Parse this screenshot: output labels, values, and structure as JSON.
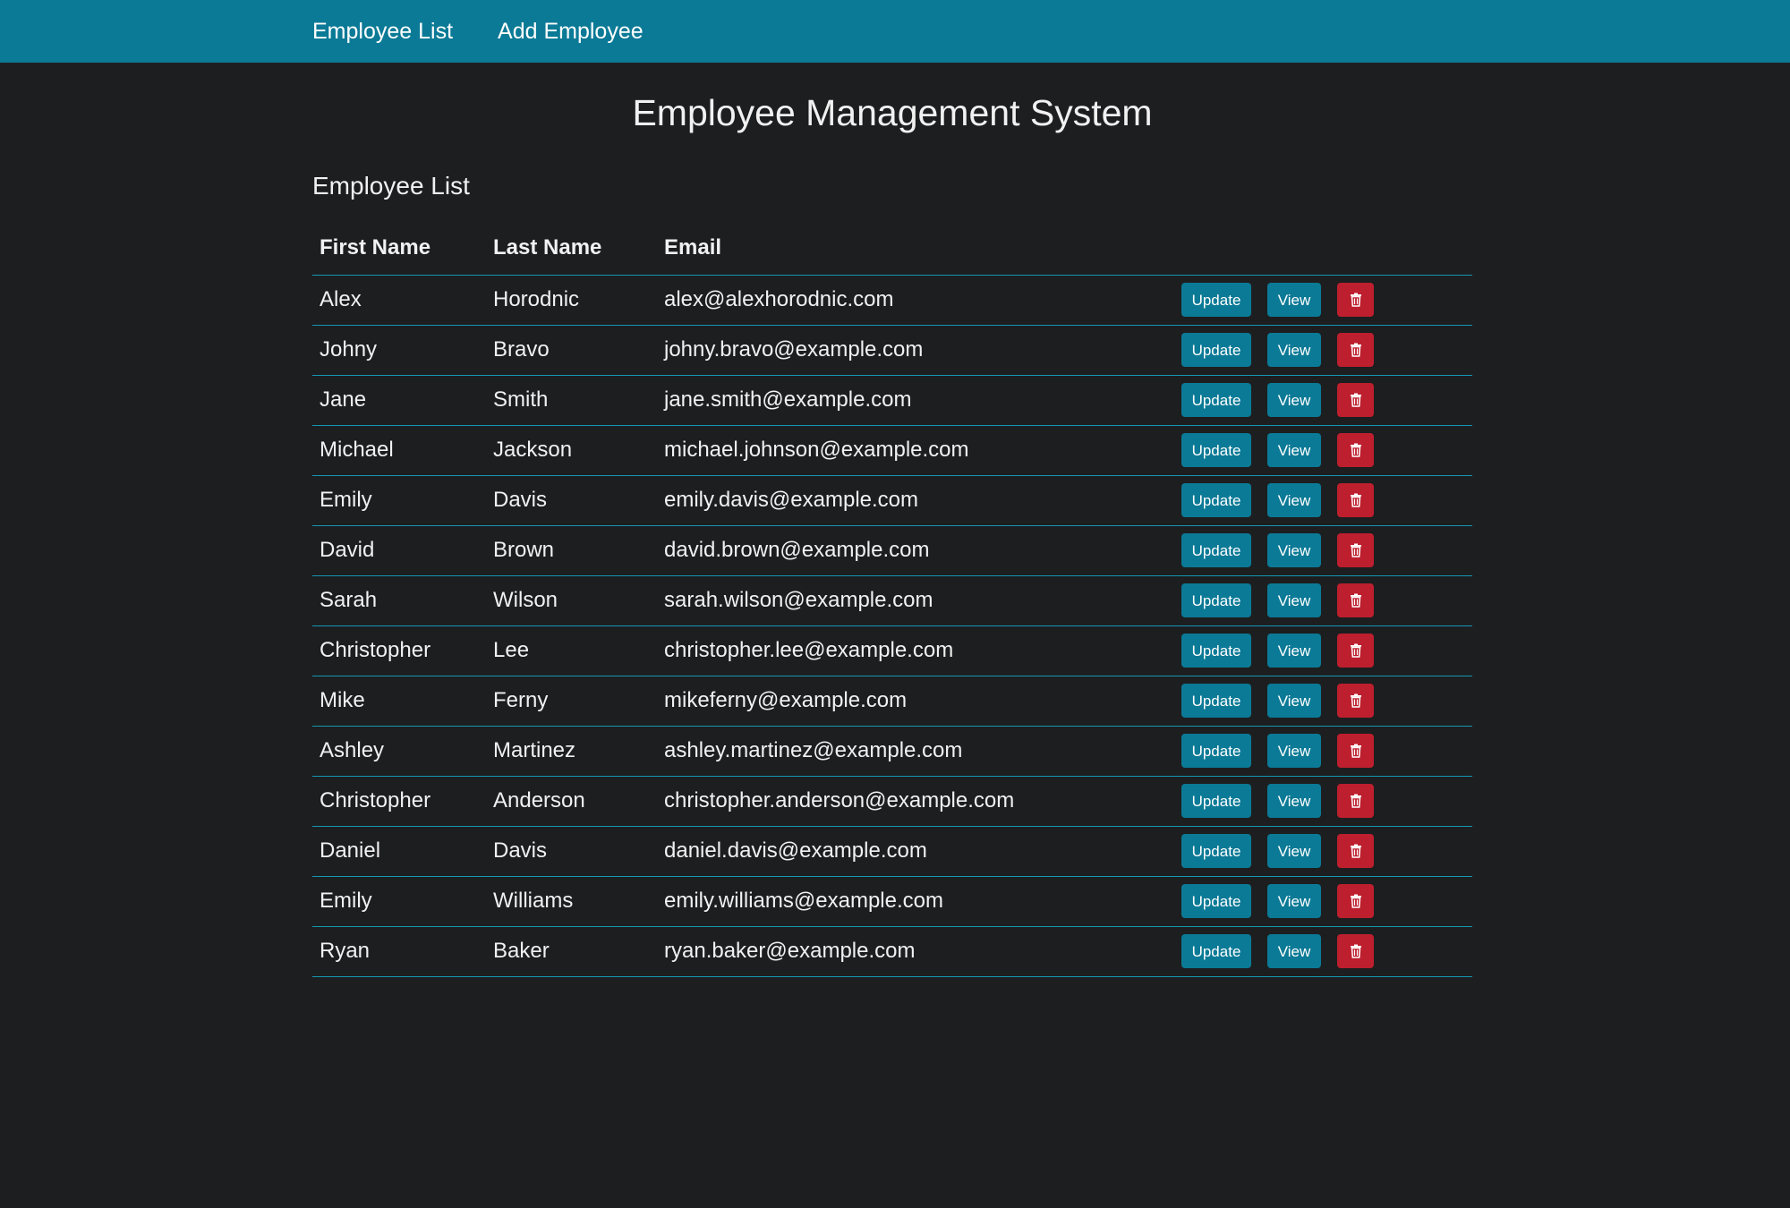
{
  "nav": {
    "items": [
      {
        "label": "Employee List"
      },
      {
        "label": "Add Employee"
      }
    ]
  },
  "page": {
    "title": "Employee Management System",
    "section_title": "Employee List"
  },
  "table": {
    "headers": [
      "First Name",
      "Last Name",
      "Email"
    ],
    "update_label": "Update",
    "view_label": "View",
    "delete_icon": "trash-icon",
    "rows": [
      {
        "first": "Alex",
        "last": "Horodnic",
        "email": "alex@alexhorodnic.com"
      },
      {
        "first": "Johny",
        "last": "Bravo",
        "email": "johny.bravo@example.com"
      },
      {
        "first": "Jane",
        "last": "Smith",
        "email": "jane.smith@example.com"
      },
      {
        "first": "Michael",
        "last": "Jackson",
        "email": "michael.johnson@example.com"
      },
      {
        "first": "Emily",
        "last": "Davis",
        "email": "emily.davis@example.com"
      },
      {
        "first": "David",
        "last": "Brown",
        "email": "david.brown@example.com"
      },
      {
        "first": "Sarah",
        "last": "Wilson",
        "email": "sarah.wilson@example.com"
      },
      {
        "first": "Christopher",
        "last": "Lee",
        "email": "christopher.lee@example.com"
      },
      {
        "first": "Mike",
        "last": "Ferny",
        "email": "mikeferny@example.com"
      },
      {
        "first": "Ashley",
        "last": "Martinez",
        "email": "ashley.martinez@example.com"
      },
      {
        "first": "Christopher",
        "last": "Anderson",
        "email": "christopher.anderson@example.com"
      },
      {
        "first": "Daniel",
        "last": "Davis",
        "email": "daniel.davis@example.com"
      },
      {
        "first": "Emily",
        "last": "Williams",
        "email": "emily.williams@example.com"
      },
      {
        "first": "Ryan",
        "last": "Baker",
        "email": "ryan.baker@example.com"
      }
    ]
  },
  "colors": {
    "navbar": "#0b7a96",
    "background": "#1d1e20",
    "primary_button": "#0b7a96",
    "danger_button": "#bd1f2e",
    "row_border": "#1497b3"
  }
}
